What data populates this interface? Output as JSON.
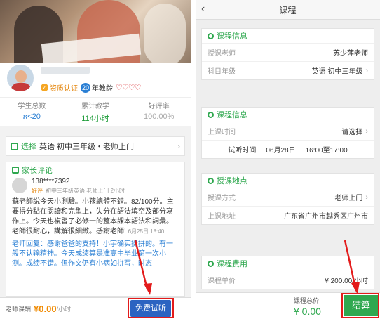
{
  "left": {
    "teacher_name": "苏少萍老师",
    "qualification": "资质认证",
    "years_num": "20",
    "years_label": "年教龄",
    "hearts": "♡♡♡♡",
    "stats": [
      {
        "label": "学生总数",
        "value": "ጸ<20"
      },
      {
        "label": "累计教学",
        "value": "114小时"
      },
      {
        "label": "好评率",
        "value": "100.00%"
      }
    ],
    "select": {
      "prefix": "选择",
      "text": "英语 初中三年级・老师上门",
      "chevron": "›"
    },
    "review": {
      "title": "家长评论",
      "phone": "138****7392",
      "good": "好评",
      "meta": "初中三年级英语 老师上门 2小时",
      "body": "蘇老師說今天小測驗。小孩總體不錯。82/100分。主要得分點在閱讀和完型上，失分在語法填空及部分寫作上。今天也複習了必修一的整本課本語法和詞彙。老師很耐心，講解很細緻。感謝老師!",
      "date": "6月25日 18:40",
      "reply": "老师回复：感谢爸爸的支持！小宇确实挺拼的。有一般不认输精神。今天成绩算是准高中毕业第一次小测。成绩不错。但作文仍有小病如拼写，时态"
    },
    "bottom": {
      "label": "老师课酬",
      "price": "¥0.00",
      "unit": "/小时",
      "trial_button": "免费试听"
    }
  },
  "right": {
    "header": {
      "back": "‹",
      "title": "课程"
    },
    "course_info": {
      "title": "课程信息",
      "rows": [
        {
          "key": "授课老师",
          "value": "苏少萍老师"
        },
        {
          "key": "科目年级",
          "value": "英语 初中三年级"
        }
      ]
    },
    "time_info": {
      "title": "课程信息",
      "row_key": "上课时间",
      "row_value": "请选择",
      "trial_label": "试听时间",
      "trial_date": "06月28日",
      "trial_time": "16:00至17:00"
    },
    "location": {
      "title": "授课地点",
      "rows": [
        {
          "key": "授课方式",
          "value": "老师上门"
        },
        {
          "key": "上课地址",
          "value": "广东省广州市越秀区广州市"
        }
      ]
    },
    "fee": {
      "title": "课程费用",
      "row_key": "课程单价",
      "row_value": "¥ 200.00/小时"
    },
    "bottom": {
      "total_label": "课程总价",
      "total_value": "¥ 0.00",
      "settle_button": "结算"
    }
  },
  "colors": {
    "accent_green": "#2fa84f",
    "accent_blue": "#2b63c1",
    "highlight_red": "#e31b1b",
    "price_orange": "#f08a00"
  }
}
